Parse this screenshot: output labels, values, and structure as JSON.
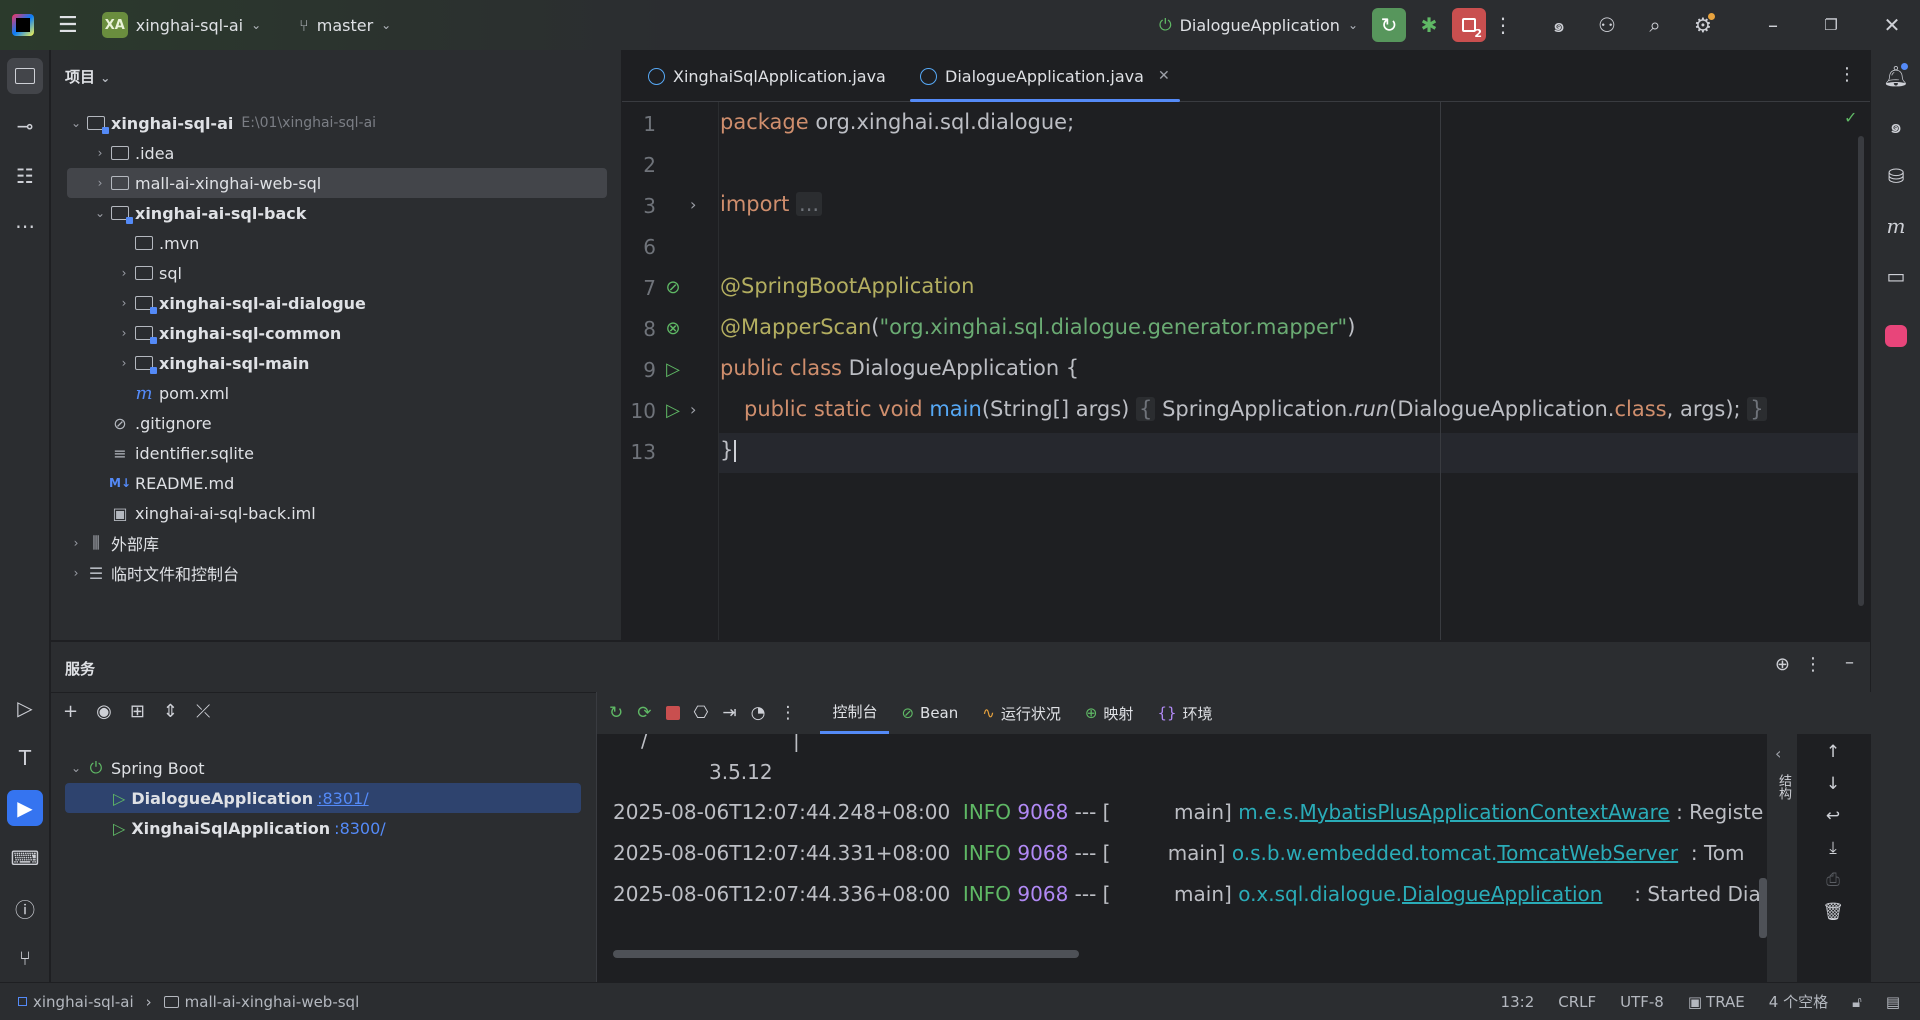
{
  "titlebar": {
    "project_badge": "XA",
    "project_name": "xinghai-sql-ai",
    "branch": "master",
    "run_config": "DialogueApplication",
    "stop_badge": "2"
  },
  "project_panel": {
    "title": "项目",
    "tree": [
      {
        "label": "xinghai-sql-ai",
        "path": "E:\\01\\xinghai-sql-ai"
      },
      {
        "label": ".idea"
      },
      {
        "label": "mall-ai-xinghai-web-sql"
      },
      {
        "label": "xinghai-ai-sql-back"
      },
      {
        "label": ".mvn"
      },
      {
        "label": "sql"
      },
      {
        "label": "xinghai-sql-ai-dialogue"
      },
      {
        "label": "xinghai-sql-common"
      },
      {
        "label": "xinghai-sql-main"
      },
      {
        "label": "pom.xml"
      },
      {
        "label": ".gitignore"
      },
      {
        "label": "identifier.sqlite"
      },
      {
        "label": "README.md"
      },
      {
        "label": "xinghai-ai-sql-back.iml"
      },
      {
        "label": "外部库"
      },
      {
        "label": "临时文件和控制台"
      }
    ]
  },
  "editor": {
    "tabs": [
      {
        "label": "XinghaiSqlApplication.java"
      },
      {
        "label": "DialogueApplication.java"
      }
    ],
    "line_numbers": [
      "1",
      "2",
      "3",
      "6",
      "7",
      "8",
      "9",
      "10",
      "13"
    ],
    "code": {
      "l1_kw": "package",
      "l1_rest": " org.xinghai.sql.dialogue;",
      "l3_kw": "import",
      "l3_fold": "...",
      "l7_ann": "@SpringBootApplication",
      "l8_ann": "@MapperScan",
      "l8_open": "(",
      "l8_str": "\"org.xinghai.sql.dialogue.generator.mapper\"",
      "l8_close": ")",
      "l9_kw": "public class",
      "l9_rest": " DialogueApplication {",
      "l10_kw": "public static void",
      "l10_fn": "main",
      "l10_args": "(String[] args) ",
      "l10_fold_open": "{",
      "l10_body": " SpringApplication.",
      "l10_run": "run",
      "l10_body2": "(DialogueApplication.",
      "l10_cls": "class",
      "l10_body3": ", args); ",
      "l10_fold_close": "}",
      "l13": "}"
    }
  },
  "services": {
    "title": "服务",
    "tree_root": "Spring Boot",
    "apps": [
      {
        "name": "DialogueApplication",
        "port": ":8301/"
      },
      {
        "name": "XinghaiSqlApplication",
        "port": ":8300/"
      }
    ],
    "console_tabs": [
      "控制台",
      "Bean",
      "运行状况",
      "映射",
      "环境"
    ],
    "log": {
      "frag1": "/",
      "frag2": "|",
      "version": "3.5.12",
      "lines": [
        {
          "ts": "2025-08-06T12:07:44.248+08:00",
          "level": "INFO",
          "pid": "9068",
          "sep": " --- [",
          "thread": "main]",
          "logger_prefix": "m.e.s.",
          "logger_class": "MybatisPlusApplicationContextAware",
          "msg": " : Registe"
        },
        {
          "ts": "2025-08-06T12:07:44.331+08:00",
          "level": "INFO",
          "pid": "9068",
          "sep": " --- [",
          "thread": "main]",
          "logger_prefix": "o.s.b.w.embedded.tomcat.",
          "logger_class": "TomcatWebServer",
          "msg": "  : Tom"
        },
        {
          "ts": "2025-08-06T12:07:44.336+08:00",
          "level": "INFO",
          "pid": "9068",
          "sep": " --- [",
          "thread": "main]",
          "logger_prefix": "o.x.sql.dialogue.",
          "logger_class": "DialogueApplication",
          "msg": "     : Started Dial"
        }
      ],
      "side_label": "结构"
    }
  },
  "statusbar": {
    "crumb1": "xinghai-sql-ai",
    "crumb2": "mall-ai-xinghai-web-sql",
    "position": "13:2",
    "line_sep": "CRLF",
    "encoding": "UTF-8",
    "trae": "TRAE",
    "indent": "4 个空格"
  }
}
